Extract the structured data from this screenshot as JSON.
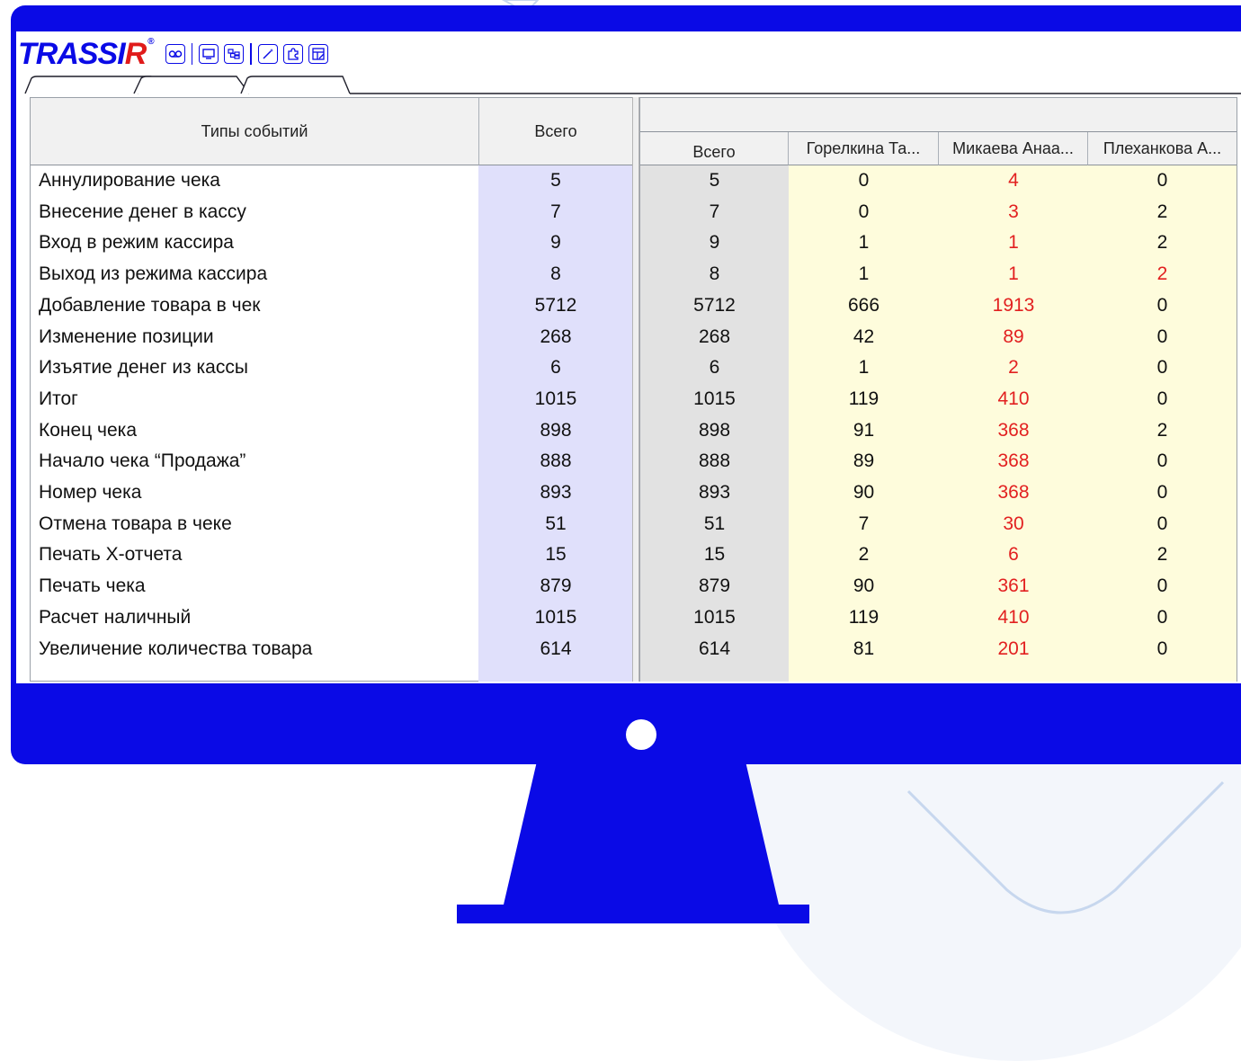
{
  "app": {
    "logo_text": "TRASSIR",
    "logo_mark": "®",
    "colors": {
      "brand_blue": "#0a0ae6",
      "brand_red": "#e01b1b",
      "highlight_red": "#e22020",
      "total_col_bg": "#e0e0fb",
      "gray_col_bg": "#e2e2e2",
      "yellow_col_bg": "#fefcdc"
    }
  },
  "toolbar": {
    "icons": [
      "voicemail-icon",
      "chat-icon",
      "hierarchy-icon",
      "magic-wand-icon",
      "puzzle-icon",
      "window-edit-icon"
    ]
  },
  "tabs": [
    "",
    "",
    ""
  ],
  "left_table": {
    "headers": {
      "event_types": "Типы событий",
      "total": "Всего"
    }
  },
  "right_table": {
    "group_header": "",
    "headers": [
      "Всего",
      "Горелкина Та...",
      "Микаева Анаа...",
      "Плеханкова А..."
    ]
  },
  "rows": [
    {
      "name": "Аннулирование чека",
      "total": "5",
      "r_total": "5",
      "c1": "0",
      "c2": "4",
      "c3": "0"
    },
    {
      "name": "Внесение денег в кассу",
      "total": "7",
      "r_total": "7",
      "c1": "0",
      "c2": "3",
      "c3": "2"
    },
    {
      "name": "Вход в режим кассира",
      "total": "9",
      "r_total": "9",
      "c1": "1",
      "c2": "1",
      "c3": "2"
    },
    {
      "name": "Выход из режима кассира",
      "total": "8",
      "r_total": "8",
      "c1": "1",
      "c2": "1",
      "c3": "2"
    },
    {
      "name": "Добавление товара в чек",
      "total": "5712",
      "r_total": "5712",
      "c1": "666",
      "c2": "1913",
      "c3": "0"
    },
    {
      "name": "Изменение позиции",
      "total": "268",
      "r_total": "268",
      "c1": "42",
      "c2": "89",
      "c3": "0"
    },
    {
      "name": "Изъятие денег из кассы",
      "total": "6",
      "r_total": "6",
      "c1": "1",
      "c2": "2",
      "c3": "0"
    },
    {
      "name": "Итог",
      "total": "1015",
      "r_total": "1015",
      "c1": "119",
      "c2": "410",
      "c3": "0"
    },
    {
      "name": "Конец чека",
      "total": "898",
      "r_total": "898",
      "c1": "91",
      "c2": "368",
      "c3": "2"
    },
    {
      "name": "Начало чека “Продажа”",
      "total": "888",
      "r_total": "888",
      "c1": "89",
      "c2": "368",
      "c3": "0"
    },
    {
      "name": "Номер чека",
      "total": "893",
      "r_total": "893",
      "c1": "90",
      "c2": "368",
      "c3": "0"
    },
    {
      "name": "Отмена товара в чеке",
      "total": "51",
      "r_total": "51",
      "c1": "7",
      "c2": "30",
      "c3": "0"
    },
    {
      "name": "Печать Х-отчета",
      "total": "15",
      "r_total": "15",
      "c1": "2",
      "c2": "6",
      "c3": "2"
    },
    {
      "name": "Печать чека",
      "total": "879",
      "r_total": "879",
      "c1": "90",
      "c2": "361",
      "c3": "0"
    },
    {
      "name": "Расчет наличный",
      "total": "1015",
      "r_total": "1015",
      "c1": "119",
      "c2": "410",
      "c3": "0"
    },
    {
      "name": "Увеличение количества товара",
      "total": "614",
      "r_total": "614",
      "c1": "81",
      "c2": "201",
      "c3": "0"
    }
  ],
  "red_cells": {
    "c2": "all",
    "c3_row_index": 3
  }
}
